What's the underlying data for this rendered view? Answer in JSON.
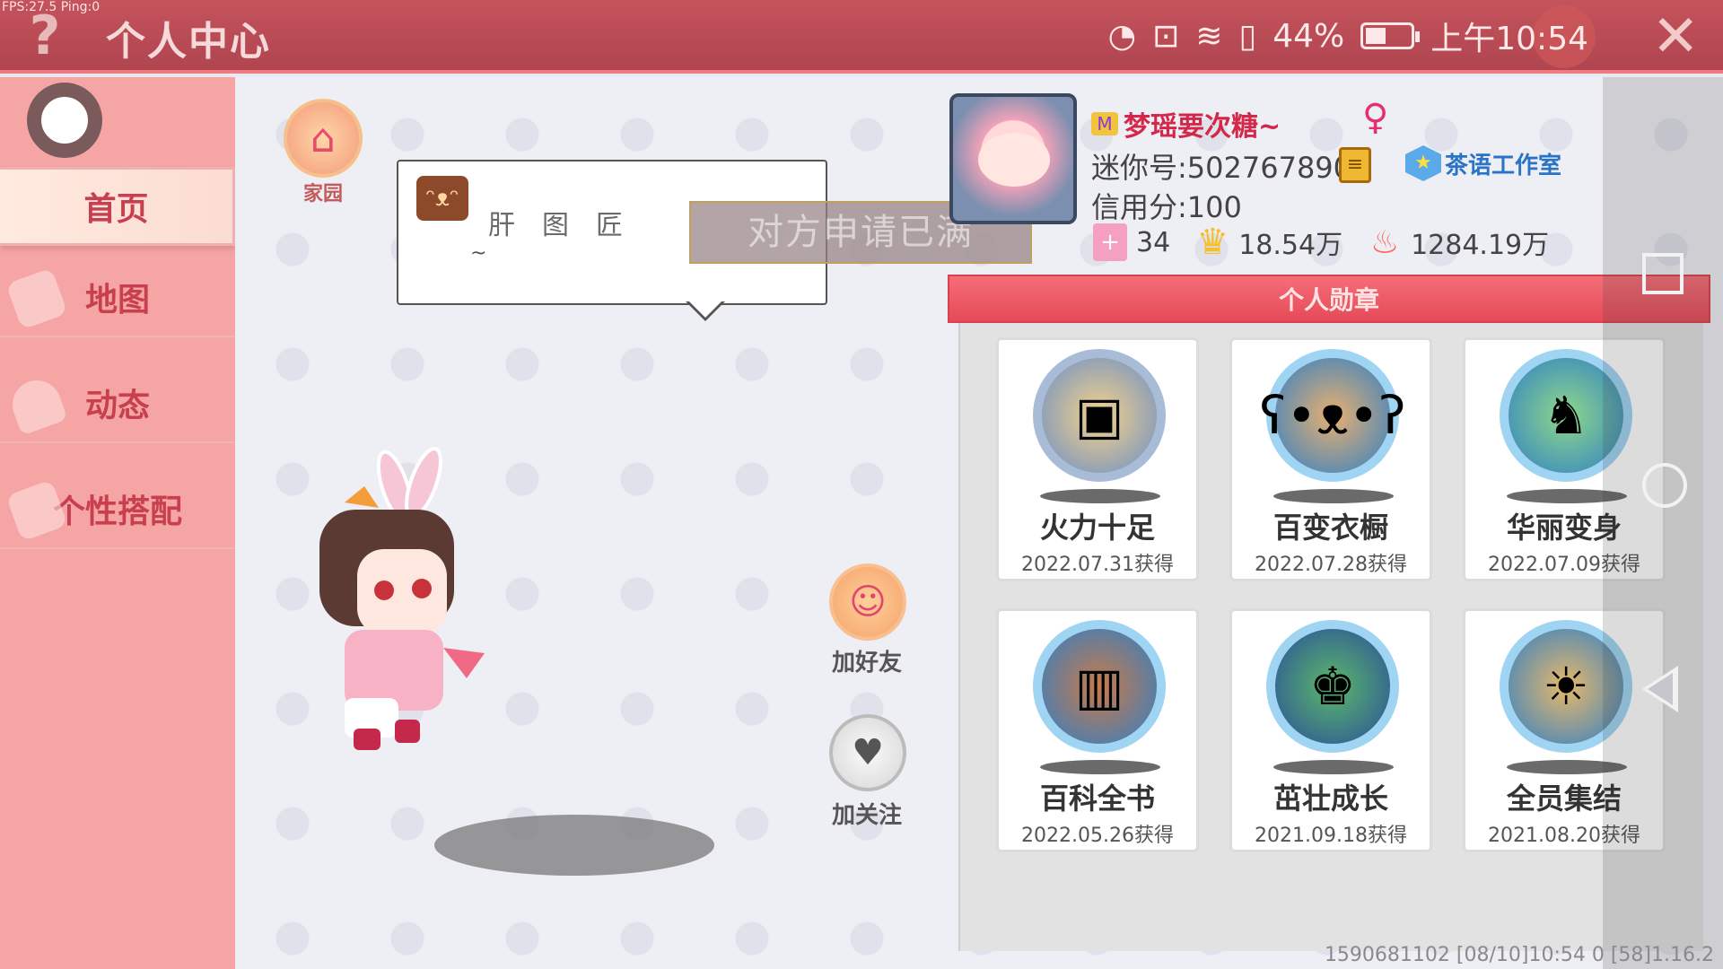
{
  "topbar": {
    "fps": "FPS:27.5 Ping:0",
    "help_icon": "question-icon",
    "title": "个人中心",
    "battery_percent": "44%",
    "time": "上午10:54",
    "close_icon": "close-icon"
  },
  "sidebar": {
    "items": [
      {
        "label": "首页",
        "active": true
      },
      {
        "label": "地图",
        "active": false
      },
      {
        "label": "动态",
        "active": false
      },
      {
        "label": "个性搭配",
        "active": false
      }
    ]
  },
  "home": {
    "label": "家园",
    "icon": "house-icon"
  },
  "bubble": {
    "text": "肝图匠",
    "tilde": "~",
    "icon": "mascot-icon"
  },
  "toast": "对方申请已满",
  "actions": {
    "add_friend": "加好友",
    "follow": "加关注"
  },
  "profile": {
    "nickname": "梦瑶要次糖~",
    "gender_symbol": "♀",
    "mini_id": "迷你号:502767890",
    "studio": "茶语工作室",
    "credit": "信用分:100",
    "stats": [
      {
        "icon": "plus-badge-icon",
        "value": "34"
      },
      {
        "icon": "trophy-icon",
        "value": "18.54万"
      },
      {
        "icon": "flame-icon",
        "value": "1284.19万"
      }
    ]
  },
  "badges": {
    "header": "个人勋章",
    "items": [
      {
        "name": "火力十足",
        "date": "2022.07.31获得",
        "icon": "treasure-chest-icon",
        "ring": "#9fb4d6"
      },
      {
        "name": "百变衣橱",
        "date": "2022.07.28获得",
        "icon": "bear-wardrobe-icon",
        "ring": "#6fc8ee"
      },
      {
        "name": "华丽变身",
        "date": "2022.07.09获得",
        "icon": "dinosaur-icon",
        "ring": "#6fc8ee"
      },
      {
        "name": "百科全书",
        "date": "2022.05.26获得",
        "icon": "book-icon",
        "ring": "#6fc8ee"
      },
      {
        "name": "茁壮成长",
        "date": "2021.09.18获得",
        "icon": "frog-king-icon",
        "ring": "#6fc8ee"
      },
      {
        "name": "全员集结",
        "date": "2021.08.20获得",
        "icon": "lion-icon",
        "ring": "#6fc8ee"
      }
    ]
  },
  "footer": "1590681102   [08/10]10:54 0  [58]1.16.2",
  "colors": {
    "topbar": "#b04550",
    "sidebar": "#f6a5a5",
    "accent": "#d4284a",
    "badge_header": "#e64a58"
  }
}
